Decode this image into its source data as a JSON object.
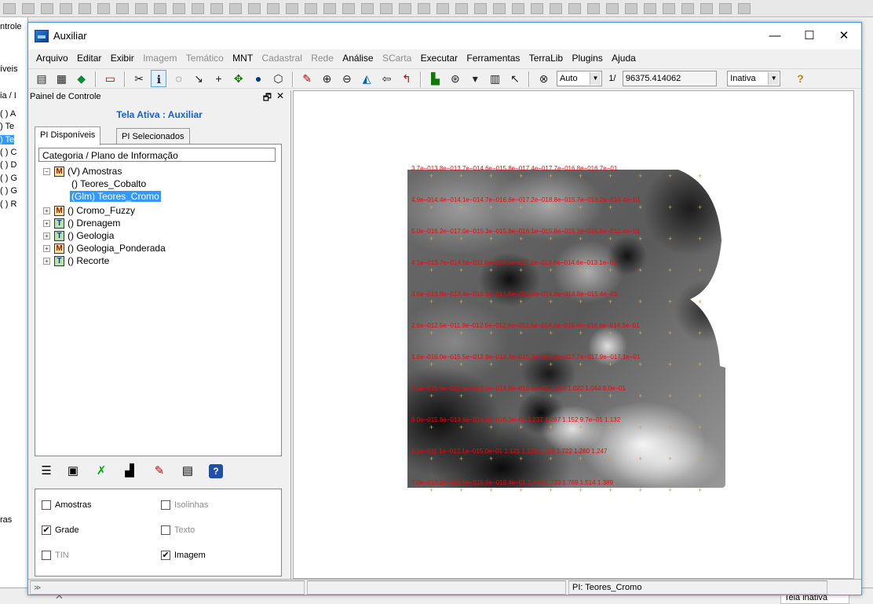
{
  "background": {
    "left_labels": [
      "ntrole",
      "íveis",
      "ia / I",
      "( ) A",
      ") Te",
      ") Te",
      "( ) C",
      "( ) D",
      "( ) G",
      "( ) G",
      "( ) R",
      "ras"
    ],
    "status_right": "Tela inativa",
    "bottom_close_glyph": "✕"
  },
  "window": {
    "title": "Auxiliar",
    "minimize_glyph": "—",
    "maximize_glyph": "☐",
    "close_glyph": "✕"
  },
  "menu": [
    {
      "label": "Arquivo",
      "enabled": true
    },
    {
      "label": "Editar",
      "enabled": true
    },
    {
      "label": "Exibir",
      "enabled": true
    },
    {
      "label": "Imagem",
      "enabled": false
    },
    {
      "label": "Temático",
      "enabled": false
    },
    {
      "label": "MNT",
      "enabled": true
    },
    {
      "label": "Cadastral",
      "enabled": false
    },
    {
      "label": "Rede",
      "enabled": false
    },
    {
      "label": "Análise",
      "enabled": true
    },
    {
      "label": "SCarta",
      "enabled": false
    },
    {
      "label": "Executar",
      "enabled": true
    },
    {
      "label": "Ferramentas",
      "enabled": true
    },
    {
      "label": "TerraLib",
      "enabled": true
    },
    {
      "label": "Plugins",
      "enabled": true
    },
    {
      "label": "Ajuda",
      "enabled": true
    }
  ],
  "toolbar": {
    "mode_combo": "Auto",
    "scale_prefix": "1/",
    "scale_value": "96375.414062",
    "state_combo": "Inativa",
    "help_glyph": "?"
  },
  "panel": {
    "title": "Painel de Controle",
    "pin_glyph": "🗗",
    "close_glyph": "✕",
    "active_screen": "Tela Ativa : Auxiliar",
    "tabs": [
      "PI Disponíveis",
      "PI Selecionados"
    ],
    "tree_header": "Categoria / Plano de Informação",
    "tree": [
      {
        "level": 0,
        "expander": "−",
        "icon": "M",
        "label": "(V) Amostras",
        "selected": false
      },
      {
        "level": 1,
        "expander": "",
        "icon": "",
        "label": "() Teores_Cobalto",
        "selected": false
      },
      {
        "level": 1,
        "expander": "",
        "icon": "",
        "label": "(Glm) Teores_Cromo",
        "selected": true
      },
      {
        "level": 0,
        "expander": "+",
        "icon": "M",
        "label": "() Cromo_Fuzzy",
        "selected": false
      },
      {
        "level": 0,
        "expander": "+",
        "icon": "T",
        "label": "() Drenagem",
        "selected": false
      },
      {
        "level": 0,
        "expander": "+",
        "icon": "T",
        "label": "() Geologia",
        "selected": false
      },
      {
        "level": 0,
        "expander": "+",
        "icon": "M",
        "label": "() Geologia_Ponderada",
        "selected": false
      },
      {
        "level": 0,
        "expander": "+",
        "icon": "T",
        "label": "() Recorte",
        "selected": false
      }
    ],
    "checks": [
      {
        "label": "Amostras",
        "checked": false,
        "enabled": true
      },
      {
        "label": "Isolinhas",
        "checked": false,
        "enabled": false
      },
      {
        "label": "Grade",
        "checked": true,
        "enabled": true
      },
      {
        "label": "Texto",
        "checked": false,
        "enabled": false
      },
      {
        "label": "TIN",
        "checked": false,
        "enabled": false
      },
      {
        "label": "Imagem",
        "checked": true,
        "enabled": true
      }
    ]
  },
  "grid_labels": [
    "3.7e−013.8e−013.7e−014.6e−015.8e−017.4e−017.7e−016.8e−016.7e−01",
    "4.9e−014.4e−014.1e−014.7e−016.6e−017.2e−018.8e−015.7e−016.2e−014.4e−01",
    "5.0e−016.2e−017.0e−015.3e−015.8e−016.1e−015.8e−015.1e−015.8e−012.4e−01",
    "4.1e−013.7e−014.6e−011.6e−014.6e−017.1e−013.6e−014.6e−013.1e−01",
    "3.6e−013.8e−013.4e−013.1e−013.6e−013.2e−014.6e−014.8e−015.4e−01",
    "2.6e−012.5e−011.9e−012.6e−012.6e−013.5e−014.6e−015.6e−016.6e−014.5e−01",
    "1.6e−016.0e−015.5e−012.8e−014.4e−015.3e−015.6e−017.7e−017.9e−017.1e−01",
    "4.5e−015.4e−012.5e−013.0e−014.8e−015.6e−01 1.063   1.022   1.044 8.0e−01",
    "9.0e−015.8e−013.6e−014.8e−016.3e−01 1.237   1.267   1.152 9.7e−01 1.132",
    "1.1e−011.1e−012.1e−015.0e−01 1.121   1.228   1.728   1.722   1.260   1.247",
    "7.0e−013.2e−013.6e−015.6e−019.4e−01 1.444   1.733   1.769   1.514   1.389"
  ],
  "statusbar": {
    "left_glyph": "≫",
    "pi_label": "PI: Teores_Cromo"
  }
}
